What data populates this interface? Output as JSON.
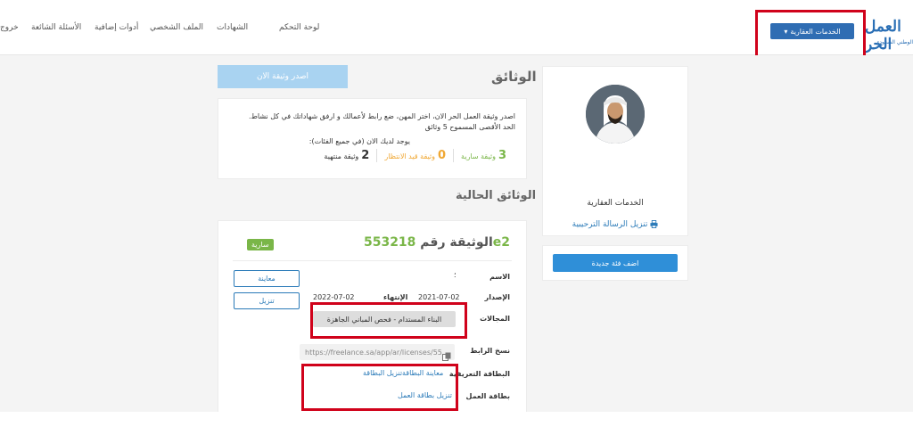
{
  "header": {
    "logo": {
      "line1": "العمل الحر",
      "line2": "الوطني السعودي"
    },
    "nav": [
      "لوحة التحكم",
      "الشهادات",
      "الملف الشخصي",
      "أدوات إضافية",
      "الأسئلة الشائعة",
      "خروج"
    ],
    "services_button": "الخدمات العقارية",
    "services_icon": "caret-down-icon"
  },
  "profile": {
    "name": "الخدمات العقارية",
    "download_letter": "تنزيل الرسالة الترحيبية",
    "download_icon": "printer-icon",
    "add_category": "اضف فئة جديدة"
  },
  "documents": {
    "title": "الوثائق",
    "issue_button": "اصدر وثيقة الان",
    "info_line1": "اصدر وثيقة العمل الحر الان، اختر المهن، ضع رابط لأعمالك و ارفق شهاداتك في كل نشاط.",
    "info_line2": "الحد الأقصى المسموح 5 وثائق",
    "have_label": "يوجد لديك الان (في جميع الفئات):",
    "stats": [
      {
        "num": "3",
        "label": "وثيقة سارية",
        "color": "#7ab648"
      },
      {
        "num": "0",
        "label": "وثيقة قيد الانتظار",
        "color": "#f0a732"
      },
      {
        "num": "2",
        "label": "وثيقة منتهية",
        "color": "#333333"
      }
    ]
  },
  "current": {
    "title": "الوثائق الحالية",
    "cert_title_prefix": "الوثيقة رقم",
    "cert_number": "553218e2",
    "status": "سارية",
    "labels": {
      "name": "الاسم",
      "issued": "الإصدار",
      "expiry": "الإنتهاء",
      "fields": "المجالات",
      "copy_link": "نسخ الرابط",
      "id_card": "البطاقة التعريفية",
      "work_card": "بطاقة العمل"
    },
    "name_value": "؛",
    "issue_date": "2021-07-02",
    "expiry_date": "2022-07-02",
    "field_tag": "البناء المستدام - فحص المباني الجاهزة",
    "link": "https://freelance.sa/app/ar/licenses/55...",
    "view_button": "معاينة",
    "download_button": "تنزيل",
    "view_card": "معاينة البطاقة",
    "download_card": "تنزيل البطاقة",
    "download_work_card": "تنزيل بطاقة العمل"
  }
}
